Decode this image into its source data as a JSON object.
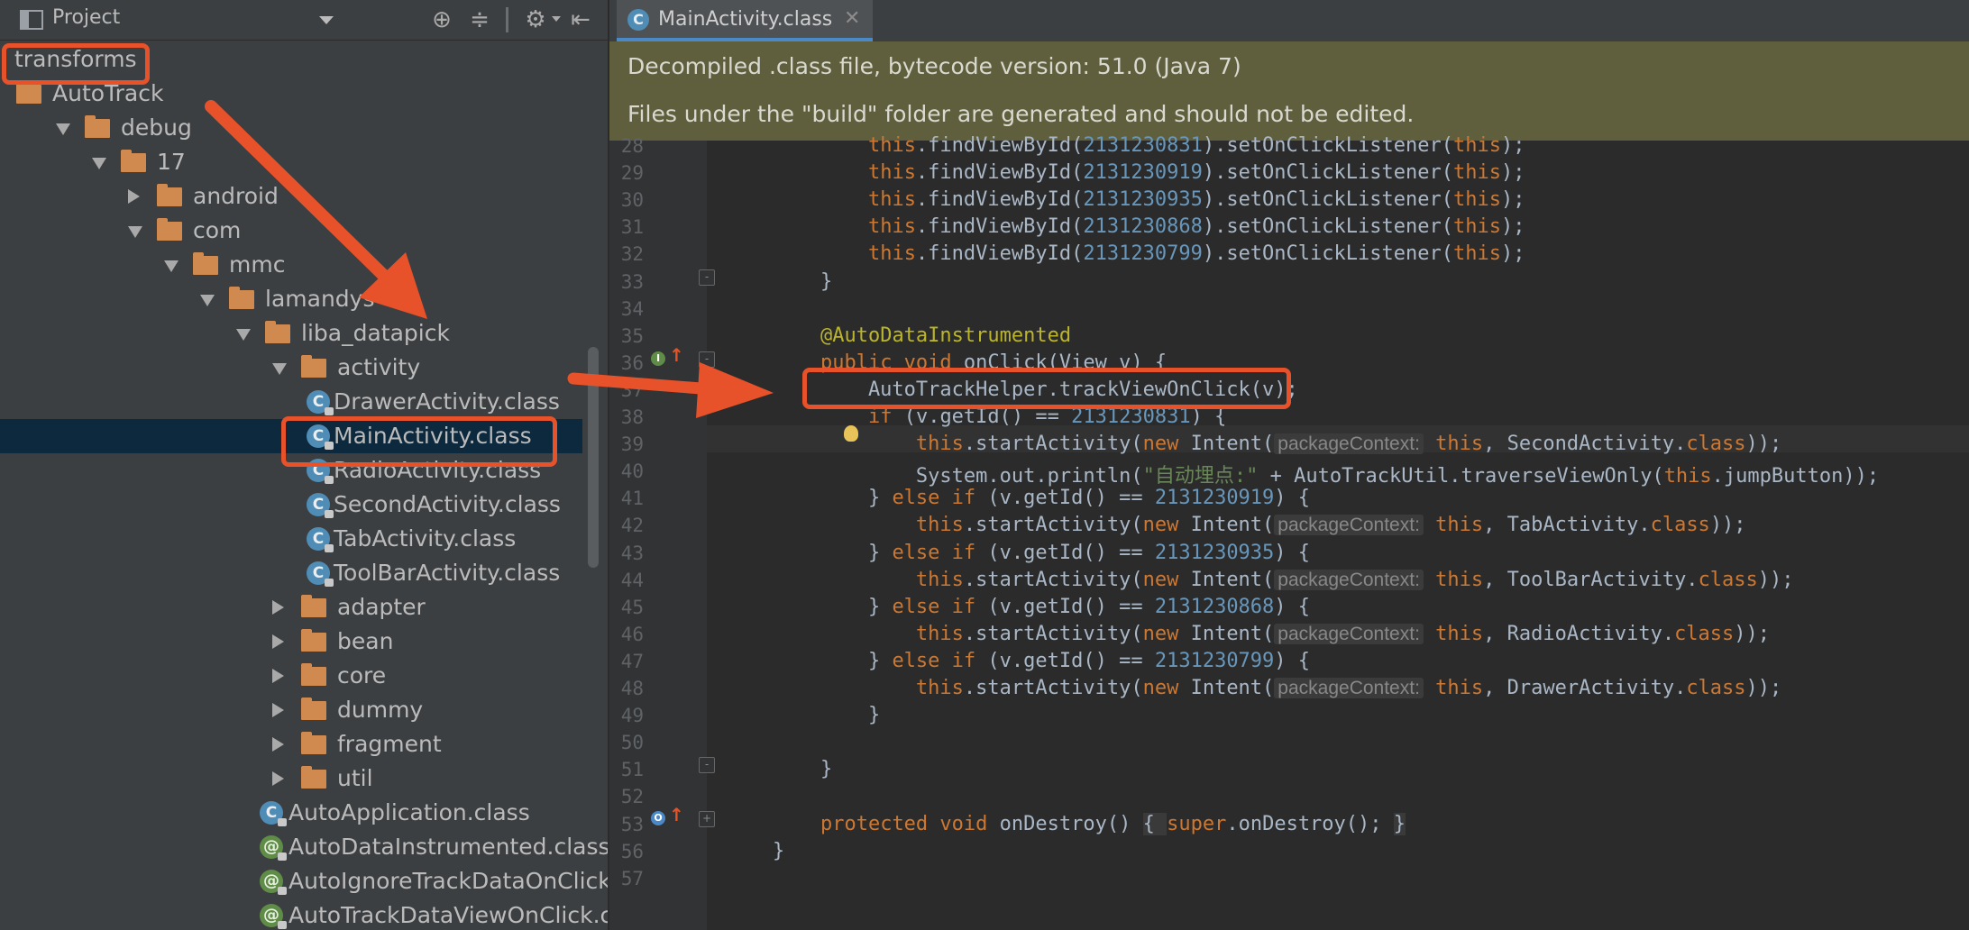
{
  "project_panel": {
    "title": "Project",
    "tree": [
      {
        "label": "transforms",
        "type": "folder-plain",
        "indent": 0,
        "arrow": "none"
      },
      {
        "label": "AutoTrack",
        "type": "folder",
        "indent": 0,
        "arrow": "none"
      },
      {
        "label": "debug",
        "type": "folder",
        "indent": 1,
        "arrow": "down"
      },
      {
        "label": "17",
        "type": "folder",
        "indent": 2,
        "arrow": "down"
      },
      {
        "label": "android",
        "type": "folder",
        "indent": 3,
        "arrow": "right"
      },
      {
        "label": "com",
        "type": "folder",
        "indent": 3,
        "arrow": "down"
      },
      {
        "label": "mmc",
        "type": "folder",
        "indent": 4,
        "arrow": "down"
      },
      {
        "label": "lamandys",
        "type": "folder",
        "indent": 5,
        "arrow": "down"
      },
      {
        "label": "liba_datapick",
        "type": "folder",
        "indent": 6,
        "arrow": "down"
      },
      {
        "label": "activity",
        "type": "folder",
        "indent": 7,
        "arrow": "down"
      },
      {
        "label": "DrawerActivity.class",
        "type": "class",
        "indent": 8,
        "arrow": "none"
      },
      {
        "label": "MainActivity.class",
        "type": "class",
        "indent": 8,
        "arrow": "none",
        "selected": true
      },
      {
        "label": "RadioActivity.class",
        "type": "class",
        "indent": 8,
        "arrow": "none"
      },
      {
        "label": "SecondActivity.class",
        "type": "class",
        "indent": 8,
        "arrow": "none"
      },
      {
        "label": "TabActivity.class",
        "type": "class",
        "indent": 8,
        "arrow": "none"
      },
      {
        "label": "ToolBarActivity.class",
        "type": "class",
        "indent": 8,
        "arrow": "none"
      },
      {
        "label": "adapter",
        "type": "folder",
        "indent": 7,
        "arrow": "right"
      },
      {
        "label": "bean",
        "type": "folder",
        "indent": 7,
        "arrow": "right"
      },
      {
        "label": "core",
        "type": "folder",
        "indent": 7,
        "arrow": "right"
      },
      {
        "label": "dummy",
        "type": "folder",
        "indent": 7,
        "arrow": "right"
      },
      {
        "label": "fragment",
        "type": "folder",
        "indent": 7,
        "arrow": "right"
      },
      {
        "label": "util",
        "type": "folder",
        "indent": 7,
        "arrow": "right"
      },
      {
        "label": "AutoApplication.class",
        "type": "class",
        "indent": 7,
        "arrow": "none"
      },
      {
        "label": "AutoDataInstrumented.class",
        "type": "annotation",
        "indent": 7,
        "arrow": "none"
      },
      {
        "label": "AutoIgnoreTrackDataOnClick.class",
        "type": "annotation",
        "indent": 7,
        "arrow": "none"
      },
      {
        "label": "AutoTrackDataViewOnClick.class",
        "type": "annotation",
        "indent": 7,
        "arrow": "none"
      }
    ]
  },
  "editor": {
    "tab_title": "MainActivity.class",
    "tab_icon": "C",
    "banner_line1": "Decompiled .class file, bytecode version: 51.0 (Java 7)",
    "banner_line2": "Files under the \"build\" folder are generated and should not be edited.",
    "lines": [
      {
        "n": "28",
        "code": [
          [
            "            ",
            ""
          ],
          [
            "this",
            "kw"
          ],
          [
            ".findViewById(",
            ""
          ],
          [
            "2131230831",
            "num"
          ],
          [
            ").setOnClickListener(",
            ""
          ],
          [
            "this",
            "kw"
          ],
          [
            ");",
            ""
          ]
        ]
      },
      {
        "n": "29",
        "code": [
          [
            "            ",
            ""
          ],
          [
            "this",
            "kw"
          ],
          [
            ".findViewById(",
            ""
          ],
          [
            "2131230919",
            "num"
          ],
          [
            ").setOnClickListener(",
            ""
          ],
          [
            "this",
            "kw"
          ],
          [
            ");",
            ""
          ]
        ]
      },
      {
        "n": "30",
        "code": [
          [
            "            ",
            ""
          ],
          [
            "this",
            "kw"
          ],
          [
            ".findViewById(",
            ""
          ],
          [
            "2131230935",
            "num"
          ],
          [
            ").setOnClickListener(",
            ""
          ],
          [
            "this",
            "kw"
          ],
          [
            ");",
            ""
          ]
        ]
      },
      {
        "n": "31",
        "code": [
          [
            "            ",
            ""
          ],
          [
            "this",
            "kw"
          ],
          [
            ".findViewById(",
            ""
          ],
          [
            "2131230868",
            "num"
          ],
          [
            ").setOnClickListener(",
            ""
          ],
          [
            "this",
            "kw"
          ],
          [
            ");",
            ""
          ]
        ]
      },
      {
        "n": "32",
        "code": [
          [
            "            ",
            ""
          ],
          [
            "this",
            "kw"
          ],
          [
            ".findViewById(",
            ""
          ],
          [
            "2131230799",
            "num"
          ],
          [
            ").setOnClickListener(",
            ""
          ],
          [
            "this",
            "kw"
          ],
          [
            ");",
            ""
          ]
        ]
      },
      {
        "n": "33",
        "code": [
          [
            "        }",
            ""
          ]
        ]
      },
      {
        "n": "34",
        "code": [
          [
            "",
            ""
          ]
        ]
      },
      {
        "n": "35",
        "code": [
          [
            "        ",
            ""
          ],
          [
            "@AutoDataInstrumented",
            "ann"
          ]
        ]
      },
      {
        "n": "36",
        "code": [
          [
            "        ",
            ""
          ],
          [
            "public void ",
            "kw"
          ],
          [
            "onClick(View v) {",
            ""
          ]
        ]
      },
      {
        "n": "37",
        "code": [
          [
            "            AutoTrackHelper.trackViewOnClick(v);",
            ""
          ]
        ]
      },
      {
        "n": "38",
        "code": [
          [
            "            ",
            ""
          ],
          [
            "if ",
            "kw"
          ],
          [
            "(v.getId() == ",
            ""
          ],
          [
            "2131230831",
            "num"
          ],
          [
            ") {",
            ""
          ]
        ]
      },
      {
        "n": "39",
        "code": [
          [
            "                ",
            ""
          ],
          [
            "this",
            "kw"
          ],
          [
            ".startActivity(",
            ""
          ],
          [
            "new ",
            "kw"
          ],
          [
            "Intent(",
            ""
          ],
          [
            "packageContext:",
            "hint"
          ],
          [
            " ",
            ""
          ],
          [
            "this",
            "kw"
          ],
          [
            ", SecondActivity.",
            ""
          ],
          [
            "class",
            "kw"
          ],
          [
            "));",
            ""
          ]
        ]
      },
      {
        "n": "40",
        "code": [
          [
            "                System.out.println(",
            ""
          ],
          [
            "\"自动埋点:\"",
            "str"
          ],
          [
            " + AutoTrackUtil.traverseViewOnly(",
            ""
          ],
          [
            "this",
            "kw"
          ],
          [
            ".jumpButton));",
            ""
          ]
        ]
      },
      {
        "n": "41",
        "code": [
          [
            "            } ",
            ""
          ],
          [
            "else if ",
            "kw"
          ],
          [
            "(v.getId() == ",
            ""
          ],
          [
            "2131230919",
            "num"
          ],
          [
            ") {",
            ""
          ]
        ]
      },
      {
        "n": "42",
        "code": [
          [
            "                ",
            ""
          ],
          [
            "this",
            "kw"
          ],
          [
            ".startActivity(",
            ""
          ],
          [
            "new ",
            "kw"
          ],
          [
            "Intent(",
            ""
          ],
          [
            "packageContext:",
            "hint"
          ],
          [
            " ",
            ""
          ],
          [
            "this",
            "kw"
          ],
          [
            ", TabActivity.",
            ""
          ],
          [
            "class",
            "kw"
          ],
          [
            "));",
            ""
          ]
        ]
      },
      {
        "n": "43",
        "code": [
          [
            "            } ",
            ""
          ],
          [
            "else if ",
            "kw"
          ],
          [
            "(v.getId() == ",
            ""
          ],
          [
            "2131230935",
            "num"
          ],
          [
            ") {",
            ""
          ]
        ]
      },
      {
        "n": "44",
        "code": [
          [
            "                ",
            ""
          ],
          [
            "this",
            "kw"
          ],
          [
            ".startActivity(",
            ""
          ],
          [
            "new ",
            "kw"
          ],
          [
            "Intent(",
            ""
          ],
          [
            "packageContext:",
            "hint"
          ],
          [
            " ",
            ""
          ],
          [
            "this",
            "kw"
          ],
          [
            ", ToolBarActivity.",
            ""
          ],
          [
            "class",
            "kw"
          ],
          [
            "));",
            ""
          ]
        ]
      },
      {
        "n": "45",
        "code": [
          [
            "            } ",
            ""
          ],
          [
            "else if ",
            "kw"
          ],
          [
            "(v.getId() == ",
            ""
          ],
          [
            "2131230868",
            "num"
          ],
          [
            ") {",
            ""
          ]
        ]
      },
      {
        "n": "46",
        "code": [
          [
            "                ",
            ""
          ],
          [
            "this",
            "kw"
          ],
          [
            ".startActivity(",
            ""
          ],
          [
            "new ",
            "kw"
          ],
          [
            "Intent(",
            ""
          ],
          [
            "packageContext:",
            "hint"
          ],
          [
            " ",
            ""
          ],
          [
            "this",
            "kw"
          ],
          [
            ", RadioActivity.",
            ""
          ],
          [
            "class",
            "kw"
          ],
          [
            "));",
            ""
          ]
        ]
      },
      {
        "n": "47",
        "code": [
          [
            "            } ",
            ""
          ],
          [
            "else if ",
            "kw"
          ],
          [
            "(v.getId() == ",
            ""
          ],
          [
            "2131230799",
            "num"
          ],
          [
            ") {",
            ""
          ]
        ]
      },
      {
        "n": "48",
        "code": [
          [
            "                ",
            ""
          ],
          [
            "this",
            "kw"
          ],
          [
            ".startActivity(",
            ""
          ],
          [
            "new ",
            "kw"
          ],
          [
            "Intent(",
            ""
          ],
          [
            "packageContext:",
            "hint"
          ],
          [
            " ",
            ""
          ],
          [
            "this",
            "kw"
          ],
          [
            ", DrawerActivity.",
            ""
          ],
          [
            "class",
            "kw"
          ],
          [
            "));",
            ""
          ]
        ]
      },
      {
        "n": "49",
        "code": [
          [
            "            }",
            ""
          ]
        ]
      },
      {
        "n": "50",
        "code": [
          [
            "",
            ""
          ]
        ]
      },
      {
        "n": "51",
        "code": [
          [
            "        }",
            ""
          ]
        ]
      },
      {
        "n": "52",
        "code": [
          [
            "",
            ""
          ]
        ]
      },
      {
        "n": "53",
        "code": [
          [
            "        ",
            ""
          ],
          [
            "protected void ",
            "kw"
          ],
          [
            "onDestroy() ",
            ""
          ],
          [
            "{ ",
            "fold-box"
          ],
          [
            "super",
            "kw"
          ],
          [
            ".onDestroy(); ",
            ""
          ],
          [
            "}",
            "fold-box"
          ]
        ]
      },
      {
        "n": "56",
        "code": [
          [
            "    }",
            ""
          ]
        ]
      },
      {
        "n": "57",
        "code": [
          [
            "",
            ""
          ]
        ]
      }
    ]
  },
  "colors": {
    "annotation_red": "#e8522a",
    "selection": "#0d293e",
    "banner": "#5f5f3e"
  }
}
